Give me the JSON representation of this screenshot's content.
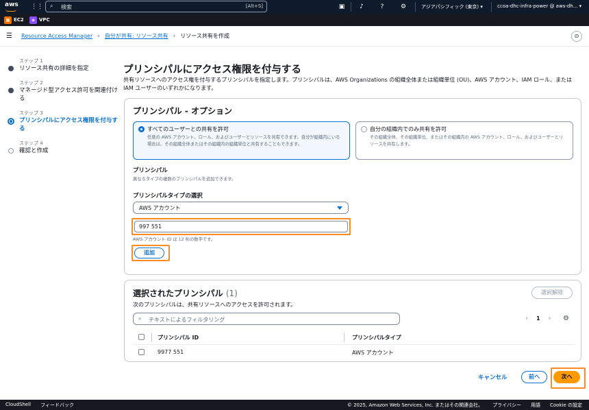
{
  "topbar": {
    "logo": "aws",
    "search_placeholder": "検索",
    "search_shortcut": "[Alt+S]",
    "region": "アジアパシフィック (東京) ▾",
    "account": "ccoa-dhc-infra-power @ aws-dh... ▾"
  },
  "favorites": [
    {
      "label": "EC2",
      "icon": "ec2-icon",
      "color": "#ed7100"
    },
    {
      "label": "VPC",
      "icon": "vpc-icon",
      "color": "#8c4fff"
    }
  ],
  "breadcrumb": {
    "items": [
      "Resource Access Manager",
      "自分が共有: リソース共有",
      "リソース共有を作成"
    ]
  },
  "steps": [
    {
      "num": "ステップ 1",
      "label": "リソース共有の詳細を指定",
      "state": "done"
    },
    {
      "num": "ステップ 2",
      "label": "マネージド型アクセス許可を関連付ける",
      "state": "done"
    },
    {
      "num": "ステップ 3",
      "label": "プリンシパルにアクセス権限を付与する",
      "state": "active"
    },
    {
      "num": "ステップ 4",
      "label": "確認と作成",
      "state": "todo"
    }
  ],
  "page": {
    "title": "プリンシパルにアクセス権限を付与する",
    "description": "共有リソースへのアクセス権を付与するプリンシパルを指定します。プリンシパルは、AWS Organizations の組織全体または組織単位 (OU)、AWS アカウント、IAM ロール、または IAM ユーザーのいずれかになります。"
  },
  "options_panel": {
    "title": "プリンシパル - オプション",
    "option1": {
      "title": "すべてのユーザーとの共有を許可",
      "desc": "任意の AWS アカウント、ロール、およびユーザーとリソースを共有できます。自分が組織内にいる場合は、その組織全体またはその組織内の組織単位と共有することもできます。"
    },
    "option2": {
      "title": "自分の組織内でのみ共有を許可",
      "desc": "その組織全体、その組織単位、またはその組織内の AWS アカウント、ロール、およびユーザーとリソースを共有します。"
    },
    "principal_label": "プリンシパル",
    "principal_hint": "異なるタイプの複数のプリンシパルを追加できます。",
    "type_label": "プリンシパルタイプの選択",
    "type_value": "AWS アカウント",
    "account_value": "997          551",
    "account_hint": "AWS アカウント ID は 12 桁の数字です。",
    "add_button": "追加"
  },
  "selected_panel": {
    "title": "選択されたプリンシパル",
    "count": "(1)",
    "desc": "次のプリンシパルは、共有リソースへのアクセスを許可されます。",
    "remove_button": "選択解除",
    "filter_placeholder": "テキストによるフィルタリング",
    "page": "1",
    "columns": [
      "プリンシパル ID",
      "プリンシパルタイプ"
    ],
    "rows": [
      {
        "id": "9977          551",
        "type": "AWS アカウント"
      }
    ]
  },
  "actions": {
    "cancel": "キャンセル",
    "prev": "前へ",
    "next": "次へ"
  },
  "footer": {
    "cloudshell": "CloudShell",
    "feedback": "フィードバック",
    "copyright": "© 2025, Amazon Web Services, Inc. またはその関連会社。",
    "privacy": "プライバシー",
    "terms": "用語",
    "cookie": "Cookie の設定"
  },
  "colors": {
    "accent": "#0972d3",
    "primary_button": "#ff9900",
    "highlight": "#ff8a1f",
    "topbar": "#0f1b2a"
  }
}
